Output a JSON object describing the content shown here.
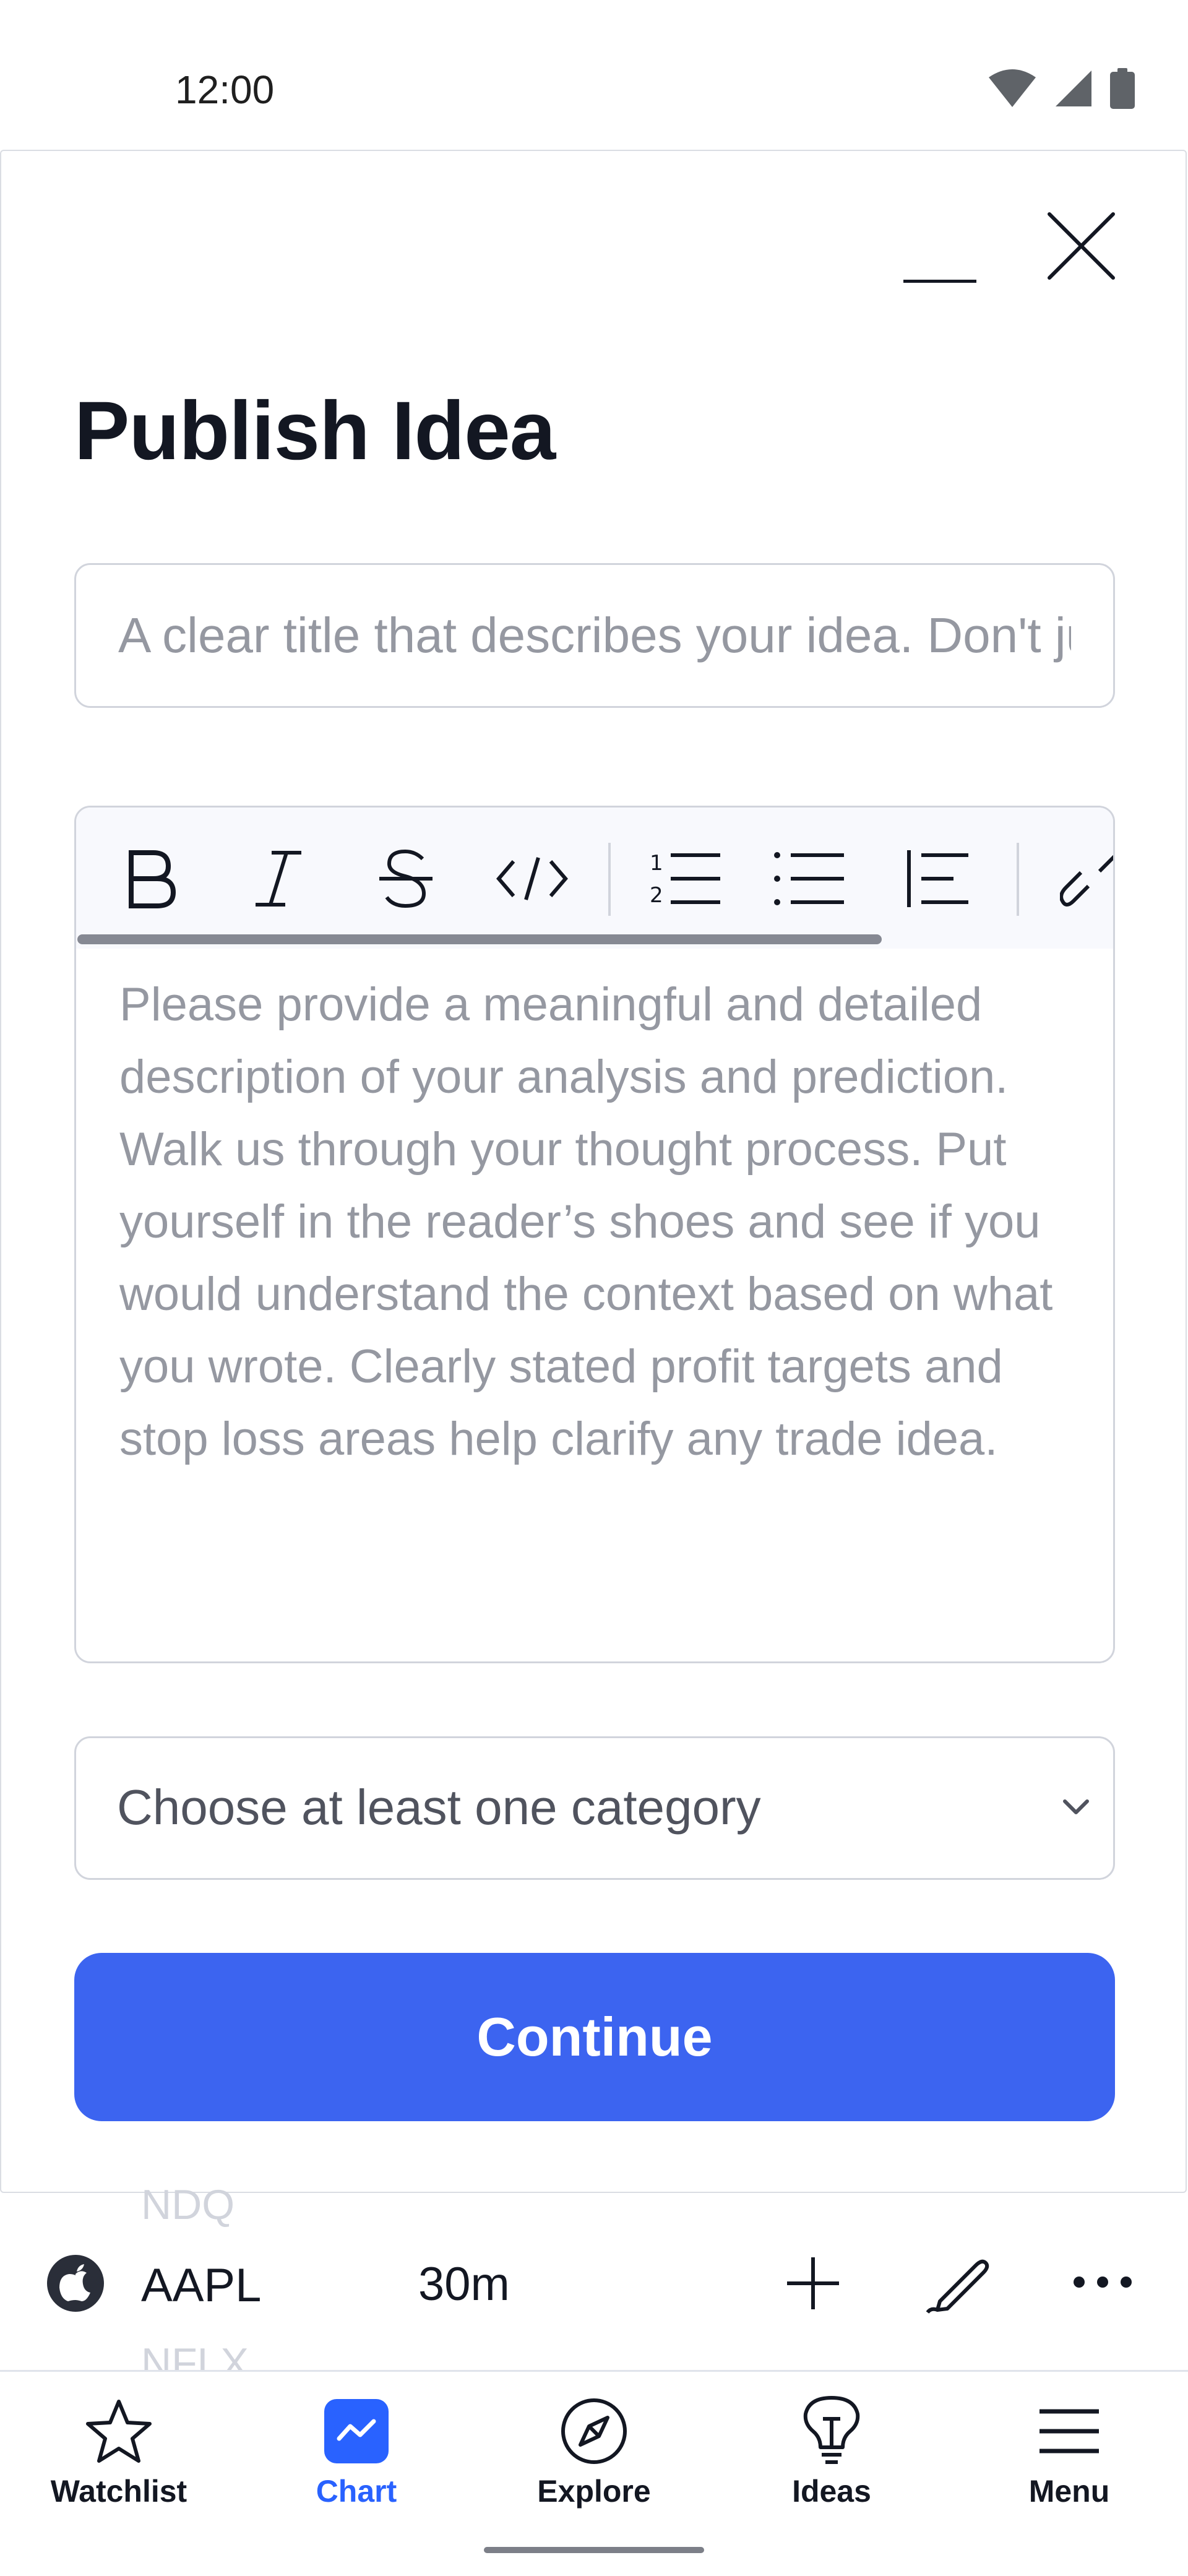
{
  "status_bar": {
    "time": "12:00",
    "icons": [
      "wifi-icon",
      "cell-signal-icon",
      "battery-icon"
    ]
  },
  "modal": {
    "title": "Publish Idea",
    "title_field": {
      "value": "",
      "placeholder": "A clear title that describes your idea. Don't just write the ticker"
    },
    "description_field": {
      "value": "",
      "placeholder": "Please provide a meaningful and detailed description of your analysis and prediction. Walk us through your thought process. Put yourself in the reader’s shoes and see if you would understand the context based on what you wrote. Clearly stated profit targets and stop loss areas help clarify any trade idea."
    },
    "toolbar": [
      "bold-icon",
      "italic-icon",
      "strikethrough-icon",
      "code-icon",
      "numbered-list-icon",
      "bulleted-list-icon",
      "blockquote-icon",
      "link-icon"
    ],
    "category_select": {
      "label": "Choose at least one category"
    },
    "continue_label": "Continue"
  },
  "symbol_bar": {
    "prev_symbol": "NDQ",
    "symbol": "AAPL",
    "next_symbol": "NFLX",
    "interval": "30m",
    "icons": [
      "plus-icon",
      "drawing-pen-icon",
      "more-icon"
    ]
  },
  "bottom_nav": {
    "items": [
      {
        "label": "Watchlist",
        "icon": "star-icon",
        "active": false
      },
      {
        "label": "Chart",
        "icon": "chart-icon",
        "active": true
      },
      {
        "label": "Explore",
        "icon": "compass-icon",
        "active": false
      },
      {
        "label": "Ideas",
        "icon": "lightbulb-icon",
        "active": false
      },
      {
        "label": "Menu",
        "icon": "hamburger-menu-icon",
        "active": false
      }
    ],
    "active_color": "#2962ff"
  },
  "colors": {
    "accent": "#3c64f0",
    "text": "#131722",
    "placeholder": "#9598a1",
    "border": "#d1d4dc"
  }
}
